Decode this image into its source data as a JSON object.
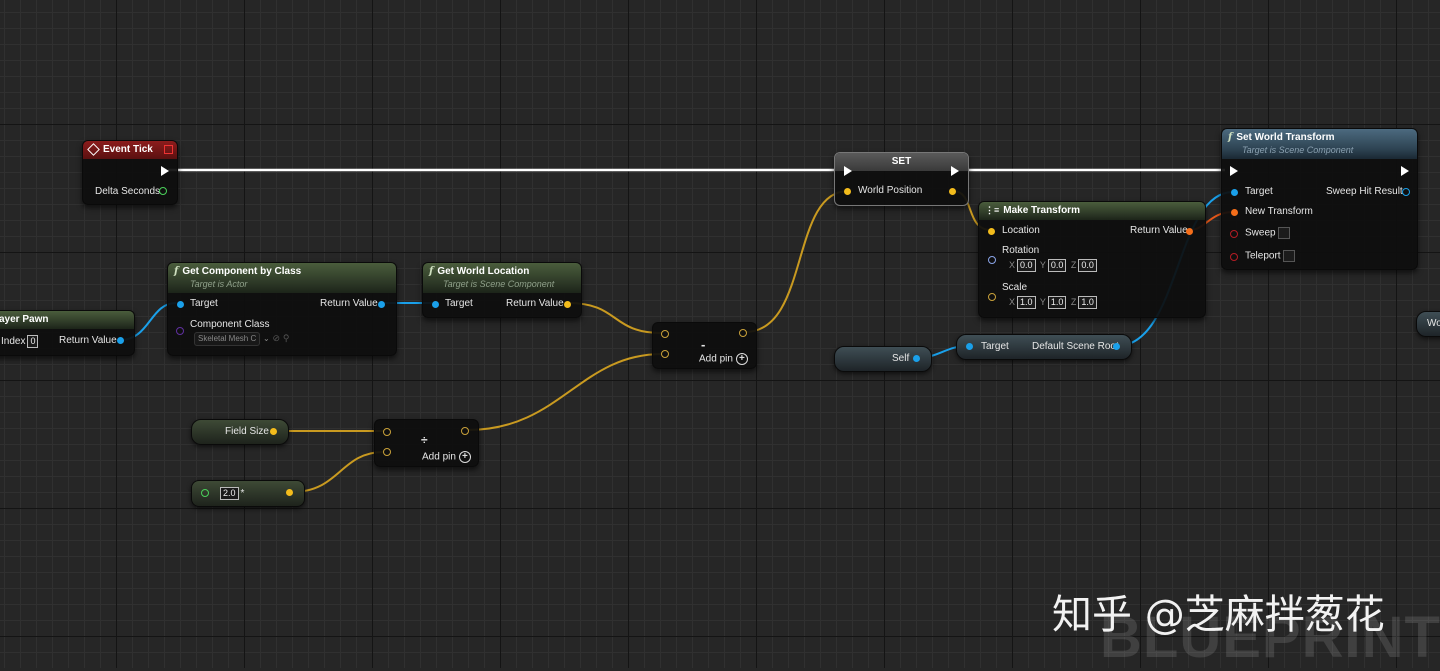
{
  "nodes": {
    "event_tick": {
      "title": "Event Tick",
      "delta_seconds": "Delta Seconds"
    },
    "get_player_pawn": {
      "title": "ayer Pawn",
      "index_label": "Index",
      "index_value": "0",
      "return_value": "Return Value"
    },
    "get_component_by_class": {
      "title": "Get Component by Class",
      "subtitle": "Target is Actor",
      "target": "Target",
      "return_value": "Return Value",
      "component_class": "Component Class",
      "component_class_value": "Skeletal Mesh C"
    },
    "get_world_location": {
      "title": "Get World Location",
      "subtitle": "Target is Scene Component",
      "target": "Target",
      "return_value": "Return Value"
    },
    "subtract": {
      "symbol": "-",
      "add_pin": "Add pin"
    },
    "divide": {
      "symbol": "÷",
      "add_pin": "Add pin"
    },
    "field_size": {
      "label": "Field Size"
    },
    "float_const": {
      "value": "2.0",
      "suffix": "*"
    },
    "set_node": {
      "title": "SET",
      "world_position": "World Position"
    },
    "make_transform": {
      "title": "Make Transform",
      "location": "Location",
      "return_value": "Return Value",
      "rotation": "Rotation",
      "rot_x": "0.0",
      "rot_y": "0.0",
      "rot_z": "0.0",
      "scale": "Scale",
      "scale_x": "1.0",
      "scale_y": "1.0",
      "scale_z": "1.0",
      "x": "X",
      "y": "Y",
      "z": "Z"
    },
    "self_ref": {
      "label": "Self"
    },
    "default_scene_root": {
      "target": "Target",
      "label": "Default Scene Root"
    },
    "set_world_transform": {
      "title": "Set World Transform",
      "subtitle": "Target is Scene Component",
      "target": "Target",
      "new_transform": "New Transform",
      "sweep": "Sweep",
      "teleport": "Teleport",
      "sweep_hit_result": "Sweep Hit Result"
    },
    "offscreen_right": {
      "label": "Wo"
    }
  },
  "watermark": "知乎 @芝麻拌葱花",
  "background_mark": "BLUEPRINT",
  "colors": {
    "exec": "#ffffff",
    "vector": "#f3bc1c",
    "object": "#1aa0ea",
    "transform": "#f46e1a",
    "float": "#7ad04a",
    "bool": "#b31c24"
  }
}
